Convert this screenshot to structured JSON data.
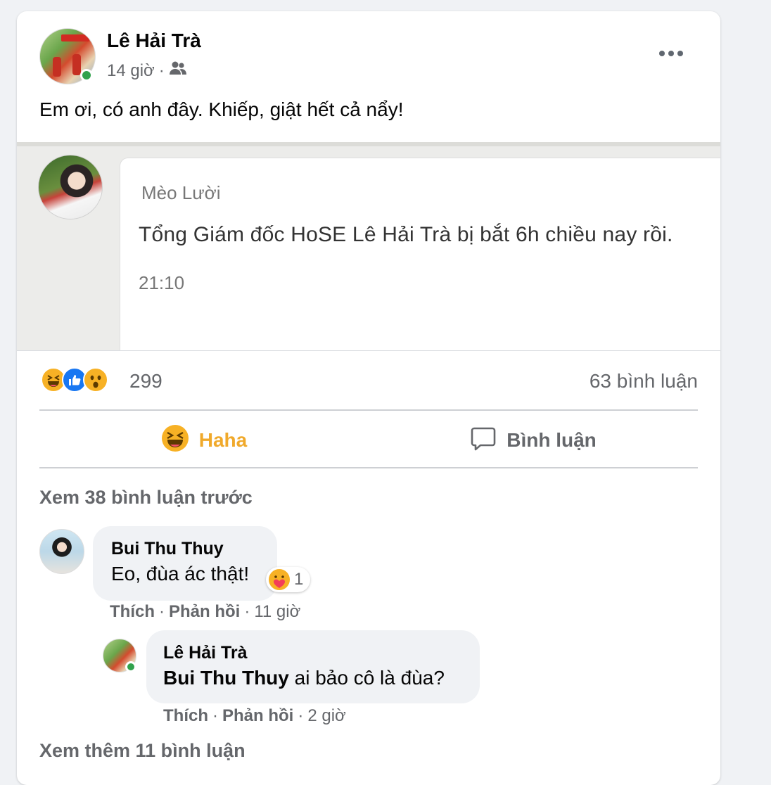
{
  "post": {
    "author": "Lê Hải Trà",
    "time": "14 giờ",
    "separator": "·",
    "audience_icon": "friends-icon",
    "text": "Em ơi, có anh đây. Khiếp, giật hết cả nẩy!"
  },
  "shared_screenshot": {
    "sender": "Mèo Lười",
    "message": "Tổng Giám đốc HoSE Lê Hải Trà bị bắt 6h chiều nay rồi.",
    "time": "21:10"
  },
  "reactions": {
    "icons": [
      "haha-icon",
      "like-icon",
      "wow-icon"
    ],
    "count": "299",
    "comments_count": "63 bình luận"
  },
  "actions": {
    "haha_label": "Haha",
    "comment_label": "Bình luận"
  },
  "comments": {
    "view_previous": "Xem 38 bình luận trước",
    "view_more": "Xem thêm 11 bình luận",
    "items": [
      {
        "author": "Bui Thu Thuy",
        "text": "Eo, đùa ác thật!",
        "reaction_icon": "care-icon",
        "reaction_count": "1",
        "like": "Thích",
        "reply": "Phản hồi",
        "time": "11 giờ"
      },
      {
        "author": "Lê Hải Trà",
        "mention": "Bui Thu Thuy",
        "text": "ai bảo cô là đùa?",
        "like": "Thích",
        "reply": "Phản hồi",
        "time": "2 giờ"
      }
    ]
  },
  "colors": {
    "haha_accent": "#f0a92b",
    "online": "#31a24c",
    "like_blue": "#1877f2",
    "muted_text": "#65676b"
  }
}
